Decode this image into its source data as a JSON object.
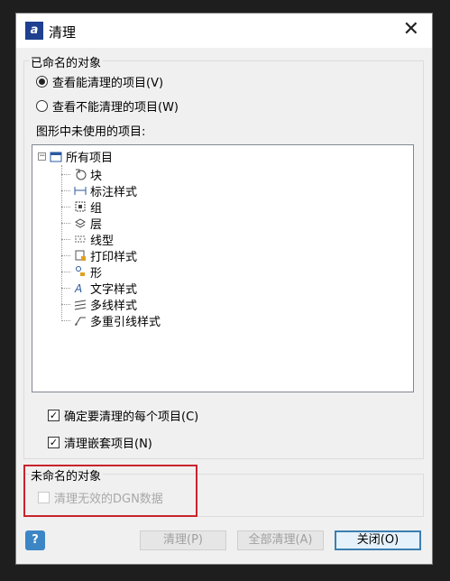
{
  "window": {
    "title": "清理",
    "close_symbol": "✕"
  },
  "named_group": {
    "label": "已命名的对象",
    "radio_purgeable": "查看能清理的项目(V)",
    "radio_not_purgeable": "查看不能清理的项目(W)",
    "tree_heading": "图形中未使用的项目:"
  },
  "tree": {
    "root_label": "所有项目",
    "items": [
      {
        "label": "块",
        "icon": "block-icon"
      },
      {
        "label": "标注样式",
        "icon": "dimension-style-icon"
      },
      {
        "label": "组",
        "icon": "group-icon"
      },
      {
        "label": "层",
        "icon": "layer-icon"
      },
      {
        "label": "线型",
        "icon": "linetype-icon"
      },
      {
        "label": "打印样式",
        "icon": "plot-style-icon"
      },
      {
        "label": "形",
        "icon": "shape-icon"
      },
      {
        "label": "文字样式",
        "icon": "text-style-icon"
      },
      {
        "label": "多线样式",
        "icon": "multiline-style-icon"
      },
      {
        "label": "多重引线样式",
        "icon": "mleader-style-icon"
      }
    ]
  },
  "options": {
    "confirm_each": "确定要清理的每个项目(C)",
    "purge_nested": "清理嵌套项目(N)"
  },
  "unnamed_group": {
    "label": "未命名的对象",
    "purge_dgn": "清理无效的DGN数据"
  },
  "buttons": {
    "help": "?",
    "purge": "清理(P)",
    "purge_all": "全部清理(A)",
    "close": "关闭(O)"
  },
  "colors": {
    "highlight_box": "#c8232c",
    "help_button": "#3d86c6",
    "default_button_border": "#3c7fb1"
  }
}
